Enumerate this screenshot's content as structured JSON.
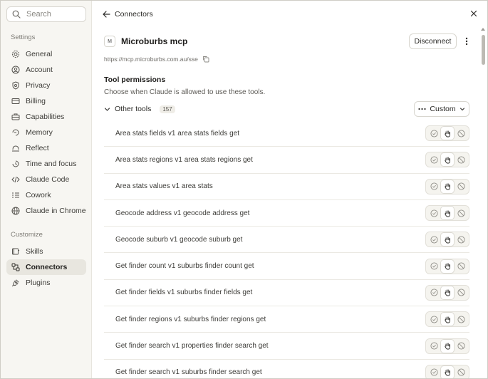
{
  "sidebar": {
    "search_placeholder": "Search",
    "settings_label": "Settings",
    "settings_items": [
      {
        "label": "General",
        "icon": "gear-icon"
      },
      {
        "label": "Account",
        "icon": "user-circle-icon"
      },
      {
        "label": "Privacy",
        "icon": "shield-icon"
      },
      {
        "label": "Billing",
        "icon": "credit-card-icon"
      },
      {
        "label": "Capabilities",
        "icon": "toolbox-icon"
      },
      {
        "label": "Memory",
        "icon": "memory-icon"
      },
      {
        "label": "Reflect",
        "icon": "reflect-icon"
      },
      {
        "label": "Time and focus",
        "icon": "timer-icon"
      },
      {
        "label": "Claude Code",
        "icon": "code-icon"
      },
      {
        "label": "Cowork",
        "icon": "list-icon"
      },
      {
        "label": "Claude in Chrome",
        "icon": "globe-icon"
      }
    ],
    "customize_label": "Customize",
    "customize_items": [
      {
        "label": "Skills",
        "icon": "skills-icon"
      },
      {
        "label": "Connectors",
        "icon": "connectors-icon",
        "active": true
      },
      {
        "label": "Plugins",
        "icon": "plug-icon"
      }
    ]
  },
  "header": {
    "back_label": "Connectors"
  },
  "server": {
    "logo_letter": "M",
    "name": "Microburbs mcp",
    "disconnect_label": "Disconnect",
    "url": "https://mcp.microburbs.com.au/sse"
  },
  "permissions": {
    "title": "Tool permissions",
    "description": "Choose when Claude is allowed to use these tools.",
    "group_label": "Other tools",
    "group_count": "157",
    "mode_label": "Custom"
  },
  "tools": [
    "Area stats fields v1 area stats fields get",
    "Area stats regions v1 area stats regions get",
    "Area stats values v1 area stats",
    "Geocode address v1 geocode address get",
    "Geocode suburb v1 geocode suburb get",
    "Get finder count v1 suburbs finder count get",
    "Get finder fields v1 suburbs finder fields get",
    "Get finder regions v1 suburbs finder regions get",
    "Get finder search v1 properties finder search get",
    "Get finder search v1 suburbs finder search get"
  ],
  "colors": {
    "sidebar_bg": "#f7f6f2",
    "active_bg": "#e8e6df",
    "text": "#2b2a27"
  }
}
